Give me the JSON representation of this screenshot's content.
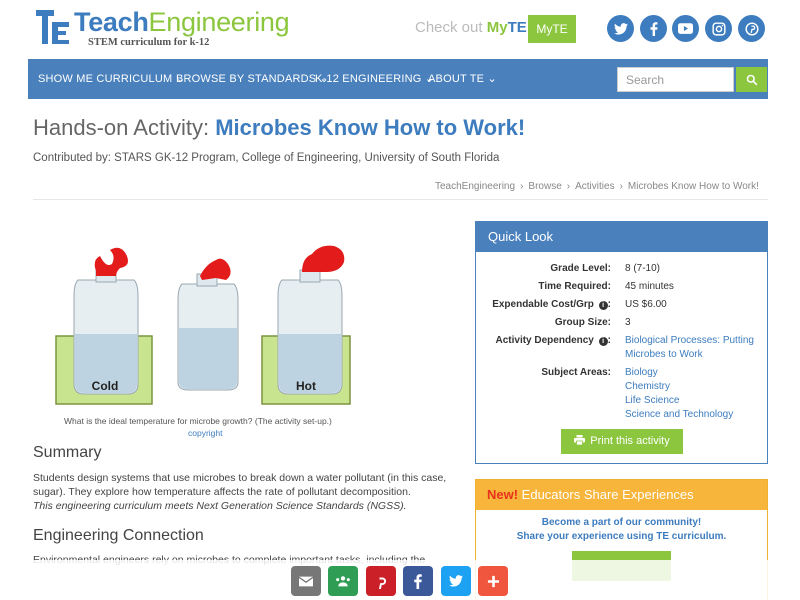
{
  "brand": {
    "name_part1": "Teach",
    "name_part2": "Engineering",
    "tagline": "STEM curriculum for k-12",
    "checkout_prefix": "Check out",
    "checkout_my": "My",
    "checkout_te": "TE",
    "myte_button": "MyTE"
  },
  "social": [
    "twitter-icon",
    "facebook-icon",
    "youtube-icon",
    "instagram-icon",
    "pinterest-icon"
  ],
  "nav": {
    "items": [
      {
        "label": "SHOW ME CURRICULUM ⌄"
      },
      {
        "label": "BROWSE BY STANDARDS ⌄"
      },
      {
        "label": "K-12 ENGINEERING ⌄"
      },
      {
        "label": "ABOUT TE ⌄"
      }
    ],
    "search_placeholder": "Search"
  },
  "page": {
    "title_prefix": "Hands-on Activity: ",
    "title_main": "Microbes Know How to Work!",
    "contributed": "Contributed by: STARS GK-12 Program, College of Engineering, University of South Florida"
  },
  "breadcrumb": [
    "TeachEngineering",
    "Browse",
    "Activities",
    "Microbes Know How to Work!"
  ],
  "figure": {
    "label_left": "Cold",
    "label_right": "Hot",
    "caption": "What is the ideal temperature for microbe growth? (The activity set-up.)",
    "copyright": "copyright"
  },
  "summary": {
    "heading": "Summary",
    "text": "Students design systems that use microbes to break down a water pollutant (in this case, sugar). They explore how temperature affects the rate of pollutant decomposition.",
    "ngss": "This engineering curriculum meets Next Generation Science Standards (NGSS)."
  },
  "engineering": {
    "heading": "Engineering Connection",
    "text": "Environmental engineers rely on microbes to complete important tasks, including the"
  },
  "quicklook": {
    "heading": "Quick Look",
    "grade_label": "Grade Level:",
    "grade_value": "8 (7-10)",
    "time_label": "Time Required:",
    "time_value": "45 minutes",
    "cost_label": "Expendable Cost/Grp",
    "cost_value": "US $6.00",
    "group_label": "Group Size:",
    "group_value": "3",
    "dep_label": "Activity Dependency",
    "dep_value": "Biological Processes: Putting Microbes to Work",
    "subjects_label": "Subject Areas:",
    "subjects": [
      "Biology",
      "Chemistry",
      "Life Science",
      "Science and Technology"
    ],
    "print_label": "Print this activity",
    "info_glyph": "i",
    "label_colon": ":"
  },
  "educators": {
    "new_label": "New!",
    "heading": " Educators Share Experiences",
    "line1": "Become a part of our community!",
    "line2": "Share your experience using TE curriculum."
  },
  "share": [
    {
      "name": "email-share-button",
      "icon": "✉",
      "color": "#777777"
    },
    {
      "name": "classroom-share-button",
      "icon": "👥",
      "color": "#2f9e54"
    },
    {
      "name": "pinterest-share-button",
      "icon": "P",
      "color": "#cb2027"
    },
    {
      "name": "facebook-share-button",
      "icon": "f",
      "color": "#3b5998"
    },
    {
      "name": "twitter-share-button",
      "icon": "t",
      "color": "#1da1f2"
    },
    {
      "name": "more-share-button",
      "icon": "+",
      "color": "#f0553d"
    }
  ],
  "colors": {
    "primary": "#4a81bd",
    "accent": "#8cc63f",
    "orange": "#f7b53b"
  }
}
